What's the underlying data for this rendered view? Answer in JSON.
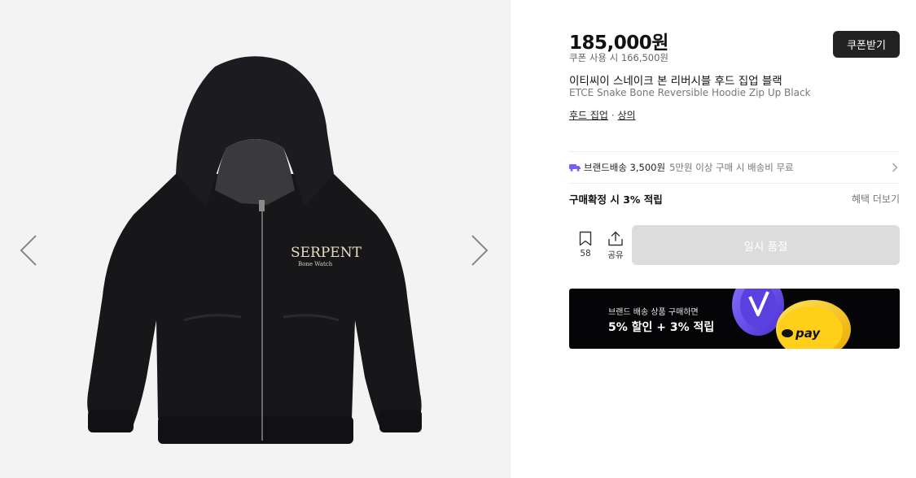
{
  "gallery": {
    "prev_icon": "chevron-left-icon",
    "next_icon": "chevron-right-icon",
    "product_image": "black-zip-hoodie",
    "print_text_1": "SERPENT",
    "print_text_2": "Bone Watch"
  },
  "product": {
    "price": "185,000원",
    "coupon_price": "쿠폰 사용 시 166,500원",
    "coupon_button": "쿠폰받기",
    "title_ko": "이티씨이 스네이크 본 리버시블 후드 집업 블랙",
    "title_en": "ETCE Snake Bone Reversible Hoodie Zip Up Black",
    "categories": [
      "후드 집업",
      "상의"
    ],
    "category_separator": "·"
  },
  "shipping": {
    "icon": "truck-icon",
    "label": "브랜드배송 3,500원",
    "note": "5만원 이상 구매 시 배송비 무료"
  },
  "points": {
    "label": "구매확정 시 3% 적립",
    "more_link": "혜택 더보기"
  },
  "actions": {
    "bookmark_count": "58",
    "share_label": "공유",
    "soldout_label": "일시 품절"
  },
  "banner": {
    "line1": "브랜드 배송 상품 구매하면",
    "line2": "5% 할인 + 3% 적립",
    "pay_text": "pay"
  },
  "colors": {
    "accent_dark": "#222222",
    "truck": "#7b5cf5",
    "soldout_bg": "#dcdcdc",
    "banner_bg": "#050507",
    "coin_purple": "#6a4ef0",
    "coin_yellow": "#ffd400"
  }
}
